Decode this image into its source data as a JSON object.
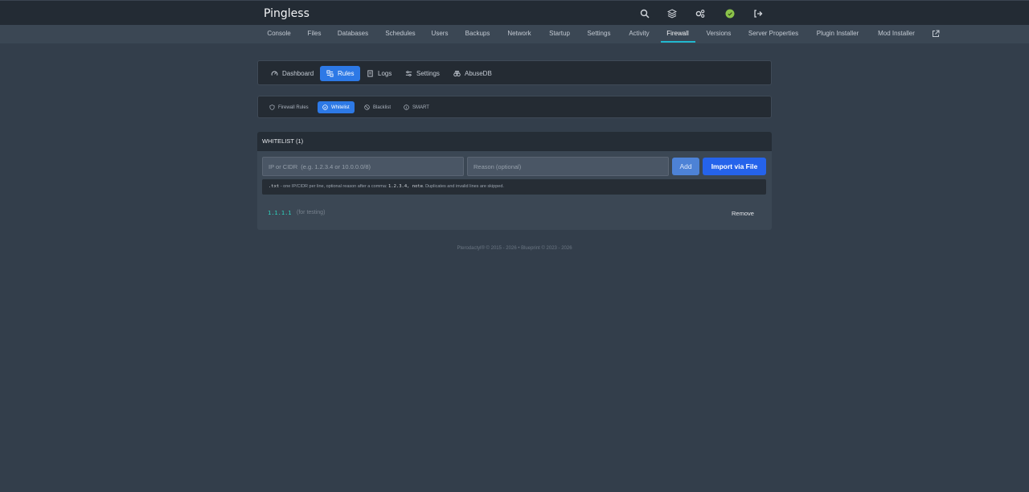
{
  "app": {
    "title": "Pingless"
  },
  "top_icons": [
    "search-icon",
    "layers-icon",
    "admin-gears-icon",
    "status-online-icon",
    "logout-icon"
  ],
  "nav": {
    "items": [
      "Console",
      "Files",
      "Databases",
      "Schedules",
      "Users",
      "Backups",
      "Network",
      "Startup",
      "Settings",
      "Activity",
      "Firewall",
      "Versions",
      "Server Properties",
      "Plugin Installer",
      "Mod Installer"
    ],
    "active": "Firewall"
  },
  "firewall_tabs": {
    "items": [
      "Dashboard",
      "Rules",
      "Logs",
      "Settings",
      "AbuseDB"
    ],
    "active": "Rules"
  },
  "rule_tabs": {
    "items": [
      "Firewall Rules",
      "Whitelist",
      "Blacklist",
      "SMART"
    ],
    "active": "Whitelist"
  },
  "whitelist": {
    "heading": "WHITELIST (1)",
    "ip_placeholder": "IP or CIDR  (e.g. 1.2.3.4 or 10.0.0.0/8)",
    "reason_placeholder": "Reason (optional)",
    "add_label": "Add",
    "import_label": "Import via File",
    "hint": {
      "ext": ".txt",
      "text1": " - one IP/CIDR per line, optional reason after a comma: ",
      "example": "1.2.3.4, note",
      "text2": ". Duplicates and invalid lines are skipped."
    },
    "entries": [
      {
        "ip": "1.1.1.1",
        "note": "(for testing)",
        "action": "Remove"
      }
    ]
  },
  "footer": "Pterodactyl® © 2015 - 2026  •  Blueprint © 2023 - 2026",
  "colors": {
    "accent": "#2d79e6",
    "nav_underline": "#22b8cf",
    "ip_text": "#2dd4bf",
    "status": "#8bc34a"
  }
}
